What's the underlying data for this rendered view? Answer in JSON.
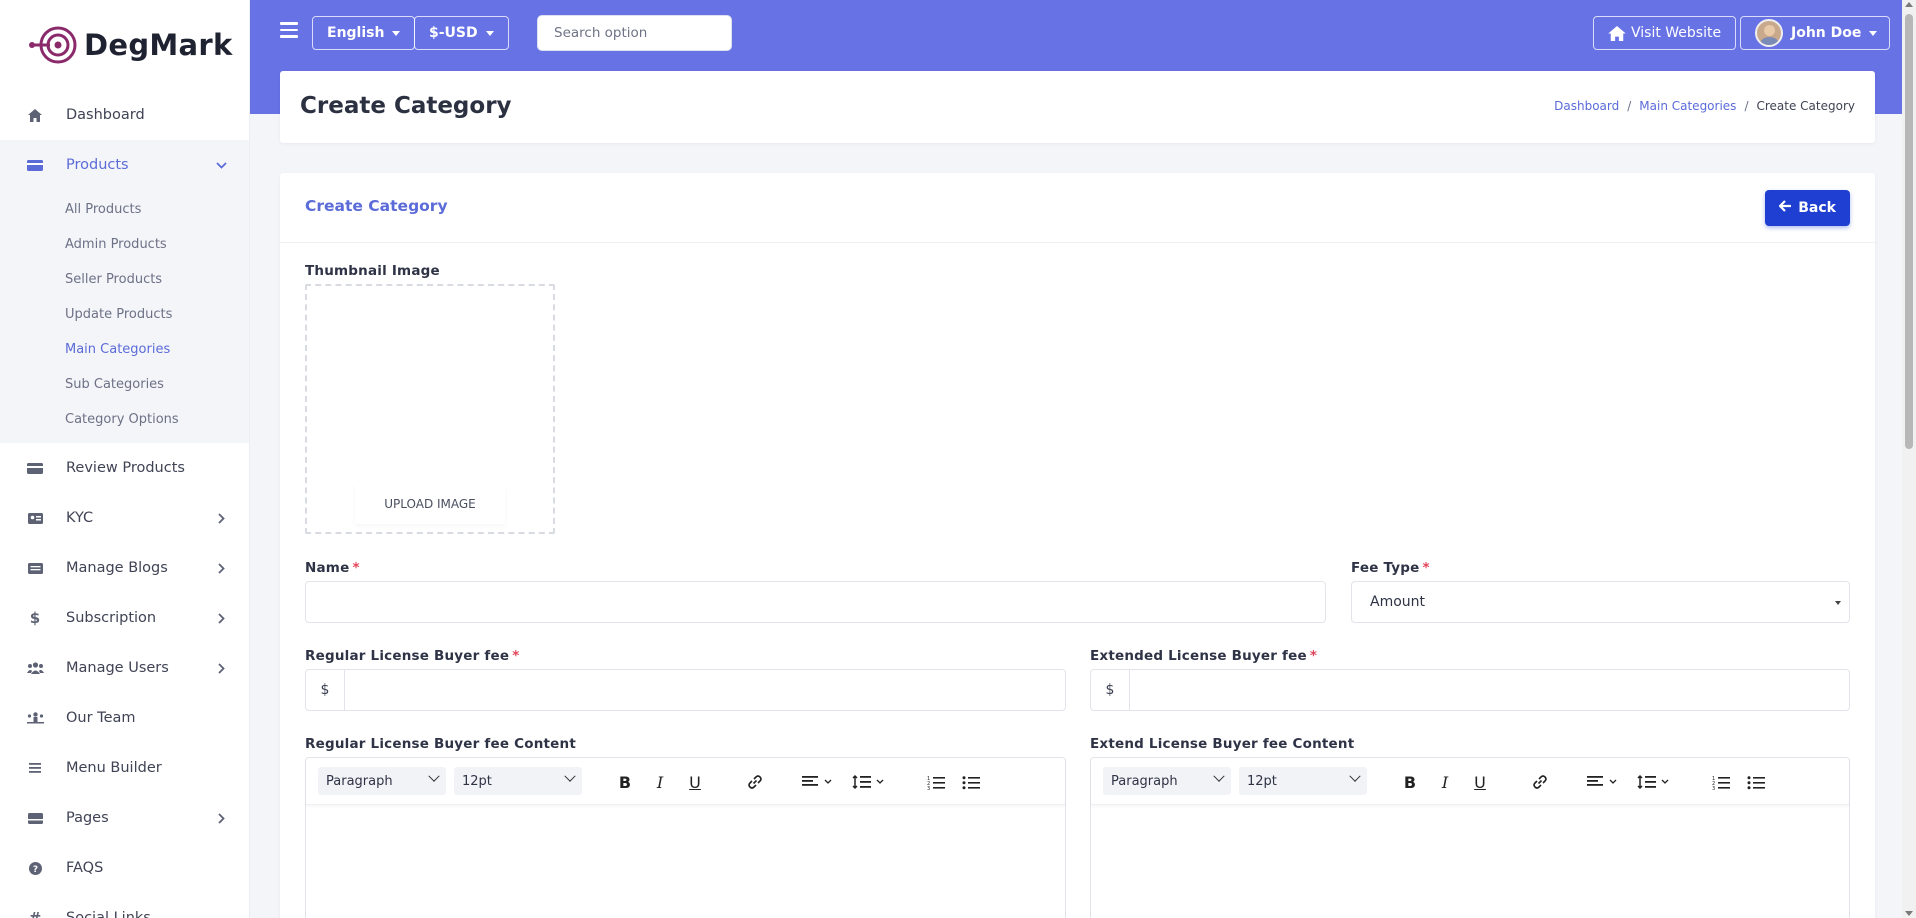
{
  "brand": {
    "name": "DegMark"
  },
  "sidebar": {
    "items": [
      {
        "label": "Dashboard",
        "icon": "home-icon",
        "glyph": "⌂"
      },
      {
        "label": "Products",
        "icon": "card-icon",
        "glyph": "▬",
        "expanded": true,
        "children": [
          "All Products",
          "Admin Products",
          "Seller Products",
          "Update Products",
          "Main Categories",
          "Sub Categories",
          "Category Options"
        ],
        "active_child": "Main Categories"
      },
      {
        "label": "Review Products",
        "icon": "card-icon",
        "glyph": "▬"
      },
      {
        "label": "KYC",
        "icon": "id-card-icon",
        "glyph": "▣"
      },
      {
        "label": "Manage Blogs",
        "icon": "blog-icon",
        "glyph": "▤"
      },
      {
        "label": "Subscription",
        "icon": "dollar-icon",
        "glyph": "$"
      },
      {
        "label": "Manage Users",
        "icon": "users-icon",
        "glyph": "⚇"
      },
      {
        "label": "Our Team",
        "icon": "team-icon",
        "glyph": "⚉"
      },
      {
        "label": "Menu Builder",
        "icon": "bars-icon",
        "glyph": "≡"
      },
      {
        "label": "Pages",
        "icon": "pages-icon",
        "glyph": "▬"
      },
      {
        "label": "FAQS",
        "icon": "question-icon",
        "glyph": "?"
      },
      {
        "label": "Social Links",
        "icon": "hash-icon",
        "glyph": "#"
      }
    ]
  },
  "topbar": {
    "language": "English",
    "currency": "$-USD",
    "search_placeholder": "Search option",
    "visit_label": "Visit Website",
    "user_name": "John Doe"
  },
  "page": {
    "title": "Create Category",
    "breadcrumb": [
      "Dashboard",
      "Main Categories",
      "Create Category"
    ]
  },
  "form": {
    "card_title": "Create Category",
    "back_label": "Back",
    "thumbnail_label": "Thumbnail Image",
    "upload_label": "UPLOAD IMAGE",
    "name_label": "Name",
    "fee_type_label": "Fee Type",
    "fee_type_value": "Amount",
    "regular_fee_label": "Regular License Buyer fee",
    "extended_fee_label": "Extended License Buyer fee",
    "currency_prefix": "$",
    "regular_content_label": "Regular License Buyer fee Content",
    "extend_content_label": "Extend License Buyer fee Content",
    "editor": {
      "block_format": "Paragraph",
      "font_size": "12pt"
    }
  },
  "colors": {
    "accent": "#6772e5",
    "primary_button": "#1e3fd1",
    "link": "#5b6bd8",
    "required": "#e0435a"
  }
}
